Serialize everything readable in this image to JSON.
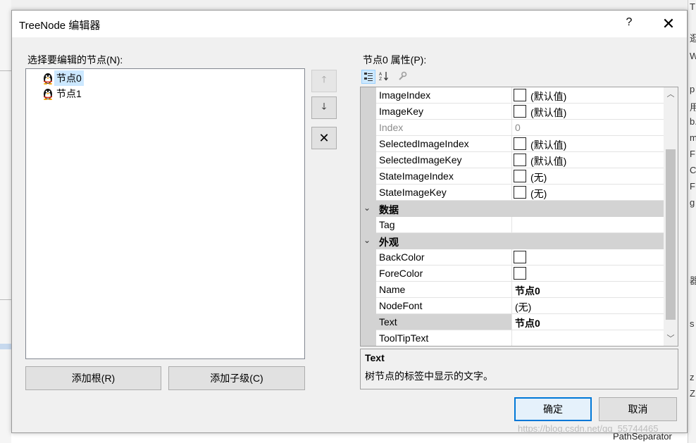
{
  "dialog": {
    "title": "TreeNode 编辑器",
    "help_label": "?",
    "close_label": "✕"
  },
  "tree_panel": {
    "label": "选择要编辑的节点(N):",
    "nodes": [
      {
        "label": "节点0",
        "selected": true
      },
      {
        "label": "节点1",
        "selected": false
      }
    ],
    "add_root_label": "添加根(R)",
    "add_child_label": "添加子级(C)"
  },
  "side_buttons": {
    "move_up": "🡑",
    "move_down": "🡓",
    "delete": "✕"
  },
  "props_panel": {
    "label": "节点0 属性(P):",
    "rows": [
      {
        "name": "ImageIndex",
        "value": "(默认值)"
      },
      {
        "name": "ImageKey",
        "value": "(默认值)"
      },
      {
        "name": "Index",
        "value": "0"
      },
      {
        "name": "SelectedImageIndex",
        "value": "(默认值)"
      },
      {
        "name": "SelectedImageKey",
        "value": "(默认值)"
      },
      {
        "name": "StateImageIndex",
        "value": "(无)"
      },
      {
        "name": "StateImageKey",
        "value": "(无)"
      }
    ],
    "category_data": {
      "name": "数据",
      "rows": [
        {
          "name": "Tag",
          "value": ""
        }
      ]
    },
    "category_appearance": {
      "name": "外观",
      "rows": [
        {
          "name": "BackColor",
          "value": ""
        },
        {
          "name": "ForeColor",
          "value": ""
        },
        {
          "name": "Name",
          "value": "节点0"
        },
        {
          "name": "NodeFont",
          "value": "(无)"
        },
        {
          "name": "Text",
          "value": "节点0"
        },
        {
          "name": "ToolTipText",
          "value": ""
        }
      ]
    },
    "description_title": "Text",
    "description_text": "树节点的标签中显示的文字。"
  },
  "footer": {
    "ok_label": "确定",
    "cancel_label": "取消"
  },
  "background": {
    "right_snippets": [
      "T",
      "逛",
      "W",
      "p",
      "用",
      "b.",
      "m",
      "F",
      "C",
      "F",
      "g",
      "器",
      "s",
      "z",
      "Z"
    ],
    "bottom_text": "PathSeparator"
  },
  "watermark": "https://blog.csdn.net/qq_55744465",
  "colors": {
    "accent": "#0078d7",
    "selection": "#cce8ff"
  }
}
